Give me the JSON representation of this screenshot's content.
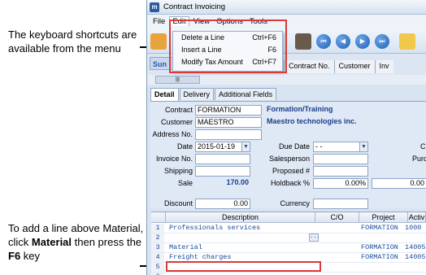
{
  "callouts": {
    "top": "The keyboard shortcuts are available from the menu",
    "bottom_pre": "To add a line above Material, click ",
    "bottom_bold1": "Material",
    "bottom_mid": " then press the ",
    "bottom_bold2": "F6",
    "bottom_post": " key"
  },
  "window": {
    "title": "Contract Invoicing",
    "app_icon": "m"
  },
  "menubar": {
    "items": [
      "File",
      "Edit",
      "View",
      "Options",
      "Tools"
    ],
    "open_index": 1
  },
  "edit_menu": {
    "items": [
      {
        "label": "Delete a Line",
        "shortcut": "Ctrl+F6"
      },
      {
        "label": "Insert a Line",
        "shortcut": "F6"
      },
      {
        "label": "Modify Tax Amount",
        "shortcut": "Ctrl+F7"
      }
    ]
  },
  "toolbar": {
    "icons": [
      "settings-icon",
      "cabinet-icon",
      "first-record-icon",
      "previous-record-icon",
      "next-record-icon",
      "last-record-icon",
      "folder-icon"
    ]
  },
  "tabstrip": {
    "summary_tab": "Sun",
    "columns": [
      "Contract No.",
      "Customer",
      "Inv"
    ]
  },
  "detail_tabs": [
    "Detail",
    "Delivery",
    "Additional Fields"
  ],
  "form": {
    "contract": {
      "label": "Contract",
      "value": "FORMATION",
      "desc": "Formation/Training"
    },
    "customer": {
      "label": "Customer",
      "value": "MAESTRO",
      "desc": "Maestro technologies inc."
    },
    "address_no": {
      "label": "Address No.",
      "value": ""
    },
    "date": {
      "label": "Date",
      "value": "2015-01-19"
    },
    "due_date": {
      "label": "Due Date",
      "value": "- -"
    },
    "invoice_no": {
      "label": "Invoice No.",
      "value": ""
    },
    "salesperson": {
      "label": "Salesperson",
      "value": ""
    },
    "shipping": {
      "label": "Shipping",
      "value": ""
    },
    "proposed": {
      "label": "Proposed #",
      "value": ""
    },
    "sale": {
      "label": "Sale",
      "value": "170.00"
    },
    "holdback": {
      "label": "Holdback %",
      "value": "0.00%",
      "value2": "0.00"
    },
    "discount": {
      "label": "Discount",
      "value": "0.00"
    },
    "currency": {
      "label": "Currency",
      "value": ""
    },
    "right_labels": [
      "C",
      "Purc"
    ]
  },
  "grid": {
    "columns": [
      "Description",
      "C/O",
      "Project",
      "Activ"
    ],
    "rows": [
      {
        "num": "1",
        "description": "Professionals services",
        "project": "FORMATION",
        "activity": "1000"
      },
      {
        "num": "2",
        "description": "",
        "project": "",
        "activity": ""
      },
      {
        "num": "3",
        "description": "Material",
        "project": "FORMATION",
        "activity": "14005"
      },
      {
        "num": "4",
        "description": "Freight charges",
        "project": "FORMATION",
        "activity": "14005"
      },
      {
        "num": "5",
        "description": "",
        "project": "",
        "activity": ""
      },
      {
        "num": "6",
        "description": "",
        "project": "",
        "activity": ""
      }
    ]
  }
}
